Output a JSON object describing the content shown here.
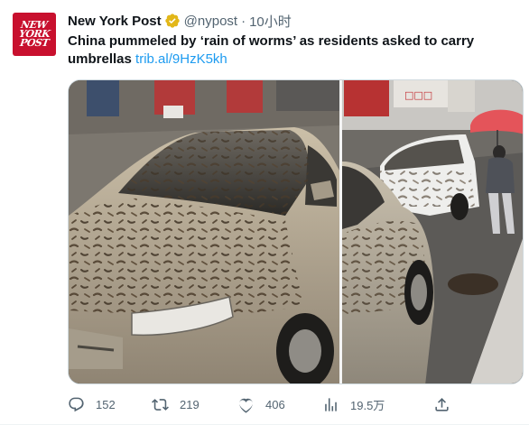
{
  "account": {
    "logo_lines": [
      "NEW",
      "YORK",
      "POST"
    ],
    "display_name": "New York Post",
    "verified_icon": "verified-badge-icon",
    "handle": "@nypost",
    "separator": "·",
    "time": "10小时"
  },
  "tweet": {
    "text": "China pummeled by ‘rain of worms’ as residents asked to carry umbrellas",
    "link": "trib.al/9HzK5kh",
    "image_alt": "Worm-covered cars on a street in China"
  },
  "actions": {
    "reply_count": "152",
    "retweet_count": "219",
    "like_count": "406",
    "view_count": "19.5万"
  },
  "colors": {
    "brand_red": "#c8102e",
    "link": "#1d9bf0",
    "muted": "#536471",
    "verified_gold": "#e2b719"
  }
}
